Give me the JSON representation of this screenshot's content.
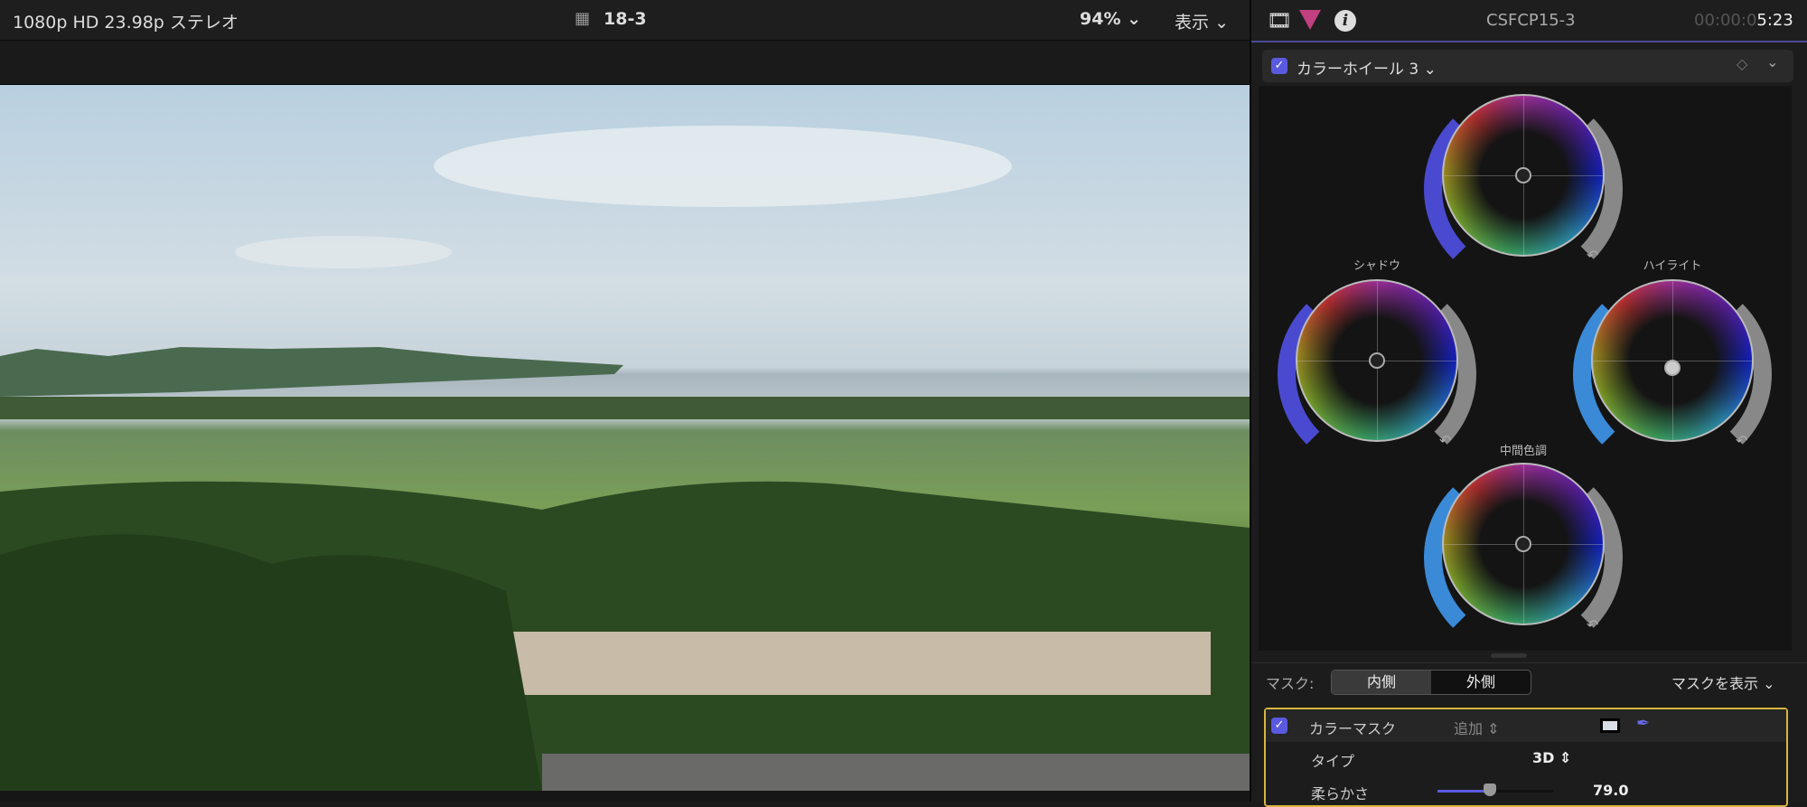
{
  "viewer": {
    "format": "1080p HD 23.98p ステレオ",
    "clip_name": "18-3",
    "zoom": "94%",
    "view_menu": "表示"
  },
  "inspector": {
    "title": "CSFCP15-3",
    "timecode_dim": "00:00:0",
    "timecode": "5:23",
    "effect": {
      "name": "カラーホイール 3",
      "enabled": true
    },
    "wheels": {
      "shadow": "シャドウ",
      "highlight": "ハイライト",
      "midtone": "中間色調"
    },
    "mask": {
      "label": "マスク:",
      "inside": "内側",
      "outside": "外側",
      "show_mask": "マスクを表示",
      "color_mask": {
        "label": "カラーマスク",
        "enabled": true,
        "mode": "追加",
        "type_label": "タイプ",
        "type_value": "3D",
        "softness_label": "柔らかさ",
        "softness_value": "79.0",
        "softness_fraction": 0.45
      }
    }
  },
  "colors": {
    "accent": "#5a5ae0",
    "mask_border": "#d8b640"
  }
}
